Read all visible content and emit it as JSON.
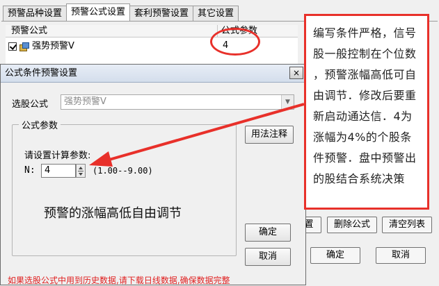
{
  "tabs": [
    {
      "label": "预警品种设置"
    },
    {
      "label": "预警公式设置"
    },
    {
      "label": "套利预警设置"
    },
    {
      "label": "其它设置"
    }
  ],
  "list": {
    "headers": [
      "预警公式",
      "公式参数"
    ],
    "rows": [
      {
        "name": "强势预警V",
        "param": "4",
        "checked": true
      }
    ]
  },
  "back_buttons": {
    "settings": "置",
    "delete": "删除公式",
    "clear": "清空列表",
    "ok": "确定",
    "cancel": "取消"
  },
  "dialog": {
    "title": "公式条件预警设置",
    "close": "×",
    "formula_label": "选股公式",
    "formula_value": "强势预警V",
    "group_title": "公式参数",
    "param_prompt": "请设置计算参数:",
    "param_name": "N:",
    "param_value": "4",
    "param_range": "(1.00--9.00)",
    "usage_button": "用法注释",
    "ok_button": "确定",
    "cancel_button": "取消",
    "caption": "预警的涨幅高低自由调节",
    "warning": "如果选股公式中用到历史数据,请下载日线数据,确保数据完整"
  },
  "annotation": {
    "lines": [
      "编写条件严格，信号",
      "股一般控制在个位数",
      "，预警涨幅高低可自",
      "由调节．修改后要重",
      "新启动通达信．4为",
      "涨幅为4%的个股条",
      "件预警．盘中预警出",
      "的股结合系统决策"
    ]
  },
  "colors": {
    "highlight": "#e8302a",
    "warning_text": "#e02020"
  }
}
